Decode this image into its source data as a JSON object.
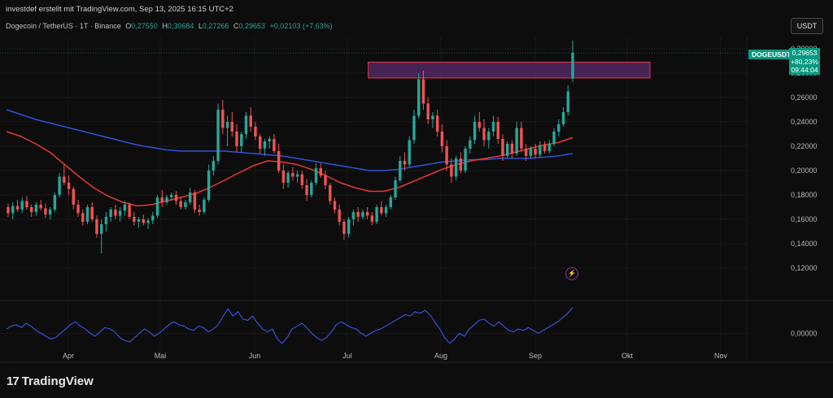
{
  "header": {
    "attribution": "investdef erstellt mit TradingView.com, Sep 13, 2025 16:15 UTC+2",
    "symbol_line": "Dogecoin / TetherUS · 1T · Binance",
    "o_label": "O",
    "o_value": "0,27550",
    "h_label": "H",
    "h_value": "0,30684",
    "l_label": "L",
    "l_value": "0,27266",
    "c_label": "C",
    "c_value": "0,29653",
    "change": "+0,02103 (+7,63%)"
  },
  "currency_button": "USDT",
  "price_tag": {
    "symbol": "DOGEUSDT",
    "price": "0,29653",
    "change_pct": "+80,23%",
    "countdown": "09:44:04"
  },
  "logo": {
    "mark": "17",
    "text": "TradingView"
  },
  "colors": {
    "up": "#26a69a",
    "down": "#ef5350",
    "ma_fast": "#e53935",
    "ma_slow": "#2f52d6",
    "oscillator": "#3d5afe",
    "zone_fill": "#5b2a6e",
    "zone_border": "#e53950",
    "background": "#0d0d0d"
  },
  "chart_data": {
    "type": "candlestick",
    "y_ticks": [
      "0,30000",
      "0,28000",
      "0,26000",
      "0,24000",
      "0,22000",
      "0,20000",
      "0,18000",
      "0,16000",
      "0,14000",
      "0,12000"
    ],
    "ylim": [
      0.11,
      0.31
    ],
    "x_ticks": [
      "Apr",
      "Mai",
      "Jun",
      "Jul",
      "Aug",
      "Sep",
      "Okt",
      "Nov"
    ],
    "candles": [
      [
        0.17,
        0.173,
        0.162,
        0.165
      ],
      [
        0.165,
        0.174,
        0.16,
        0.171
      ],
      [
        0.171,
        0.176,
        0.166,
        0.168
      ],
      [
        0.168,
        0.178,
        0.165,
        0.175
      ],
      [
        0.175,
        0.179,
        0.168,
        0.17
      ],
      [
        0.17,
        0.172,
        0.162,
        0.166
      ],
      [
        0.166,
        0.174,
        0.163,
        0.172
      ],
      [
        0.172,
        0.176,
        0.167,
        0.169
      ],
      [
        0.169,
        0.173,
        0.161,
        0.164
      ],
      [
        0.164,
        0.17,
        0.16,
        0.168
      ],
      [
        0.168,
        0.182,
        0.166,
        0.18
      ],
      [
        0.18,
        0.198,
        0.178,
        0.195
      ],
      [
        0.195,
        0.205,
        0.188,
        0.19
      ],
      [
        0.19,
        0.196,
        0.18,
        0.185
      ],
      [
        0.185,
        0.187,
        0.168,
        0.172
      ],
      [
        0.172,
        0.176,
        0.162,
        0.165
      ],
      [
        0.165,
        0.168,
        0.155,
        0.158
      ],
      [
        0.158,
        0.172,
        0.156,
        0.17
      ],
      [
        0.17,
        0.174,
        0.158,
        0.16
      ],
      [
        0.16,
        0.163,
        0.145,
        0.148
      ],
      [
        0.148,
        0.16,
        0.132,
        0.156
      ],
      [
        0.156,
        0.166,
        0.15,
        0.162
      ],
      [
        0.162,
        0.17,
        0.158,
        0.168
      ],
      [
        0.168,
        0.172,
        0.16,
        0.163
      ],
      [
        0.163,
        0.17,
        0.158,
        0.167
      ],
      [
        0.167,
        0.175,
        0.163,
        0.172
      ],
      [
        0.172,
        0.174,
        0.16,
        0.162
      ],
      [
        0.162,
        0.166,
        0.155,
        0.158
      ],
      [
        0.158,
        0.162,
        0.153,
        0.16
      ],
      [
        0.16,
        0.164,
        0.155,
        0.157
      ],
      [
        0.157,
        0.161,
        0.152,
        0.159
      ],
      [
        0.159,
        0.166,
        0.156,
        0.163
      ],
      [
        0.163,
        0.18,
        0.161,
        0.178
      ],
      [
        0.178,
        0.184,
        0.17,
        0.174
      ],
      [
        0.174,
        0.18,
        0.172,
        0.178
      ],
      [
        0.178,
        0.182,
        0.175,
        0.18
      ],
      [
        0.18,
        0.183,
        0.172,
        0.175
      ],
      [
        0.175,
        0.178,
        0.168,
        0.17
      ],
      [
        0.17,
        0.176,
        0.168,
        0.174
      ],
      [
        0.174,
        0.186,
        0.172,
        0.182
      ],
      [
        0.182,
        0.184,
        0.165,
        0.168
      ],
      [
        0.168,
        0.172,
        0.163,
        0.166
      ],
      [
        0.166,
        0.178,
        0.164,
        0.176
      ],
      [
        0.176,
        0.205,
        0.174,
        0.2
      ],
      [
        0.2,
        0.212,
        0.196,
        0.208
      ],
      [
        0.208,
        0.255,
        0.205,
        0.25
      ],
      [
        0.25,
        0.258,
        0.23,
        0.235
      ],
      [
        0.235,
        0.245,
        0.22,
        0.24
      ],
      [
        0.24,
        0.248,
        0.228,
        0.232
      ],
      [
        0.232,
        0.238,
        0.215,
        0.22
      ],
      [
        0.22,
        0.232,
        0.215,
        0.23
      ],
      [
        0.23,
        0.248,
        0.226,
        0.245
      ],
      [
        0.245,
        0.252,
        0.232,
        0.236
      ],
      [
        0.236,
        0.24,
        0.225,
        0.228
      ],
      [
        0.228,
        0.23,
        0.214,
        0.218
      ],
      [
        0.218,
        0.226,
        0.212,
        0.224
      ],
      [
        0.224,
        0.228,
        0.218,
        0.226
      ],
      [
        0.226,
        0.23,
        0.214,
        0.216
      ],
      [
        0.216,
        0.222,
        0.198,
        0.2
      ],
      [
        0.2,
        0.205,
        0.185,
        0.19
      ],
      [
        0.19,
        0.2,
        0.186,
        0.198
      ],
      [
        0.198,
        0.203,
        0.192,
        0.195
      ],
      [
        0.195,
        0.2,
        0.19,
        0.197
      ],
      [
        0.197,
        0.2,
        0.185,
        0.188
      ],
      [
        0.188,
        0.193,
        0.175,
        0.18
      ],
      [
        0.18,
        0.192,
        0.178,
        0.19
      ],
      [
        0.19,
        0.206,
        0.188,
        0.202
      ],
      [
        0.202,
        0.206,
        0.194,
        0.196
      ],
      [
        0.196,
        0.2,
        0.185,
        0.188
      ],
      [
        0.188,
        0.19,
        0.172,
        0.175
      ],
      [
        0.175,
        0.178,
        0.165,
        0.168
      ],
      [
        0.168,
        0.172,
        0.155,
        0.158
      ],
      [
        0.158,
        0.16,
        0.143,
        0.148
      ],
      [
        0.148,
        0.162,
        0.145,
        0.16
      ],
      [
        0.16,
        0.168,
        0.155,
        0.166
      ],
      [
        0.166,
        0.17,
        0.158,
        0.162
      ],
      [
        0.162,
        0.168,
        0.16,
        0.166
      ],
      [
        0.166,
        0.17,
        0.16,
        0.163
      ],
      [
        0.163,
        0.166,
        0.155,
        0.158
      ],
      [
        0.158,
        0.172,
        0.156,
        0.17
      ],
      [
        0.17,
        0.175,
        0.163,
        0.165
      ],
      [
        0.165,
        0.172,
        0.162,
        0.17
      ],
      [
        0.17,
        0.18,
        0.168,
        0.178
      ],
      [
        0.178,
        0.195,
        0.176,
        0.192
      ],
      [
        0.192,
        0.212,
        0.19,
        0.208
      ],
      [
        0.208,
        0.215,
        0.2,
        0.205
      ],
      [
        0.205,
        0.228,
        0.203,
        0.225
      ],
      [
        0.225,
        0.25,
        0.222,
        0.245
      ],
      [
        0.245,
        0.28,
        0.243,
        0.275
      ],
      [
        0.275,
        0.282,
        0.25,
        0.255
      ],
      [
        0.255,
        0.26,
        0.238,
        0.242
      ],
      [
        0.242,
        0.248,
        0.235,
        0.245
      ],
      [
        0.245,
        0.25,
        0.228,
        0.232
      ],
      [
        0.232,
        0.238,
        0.215,
        0.22
      ],
      [
        0.22,
        0.225,
        0.2,
        0.205
      ],
      [
        0.205,
        0.21,
        0.19,
        0.195
      ],
      [
        0.195,
        0.212,
        0.192,
        0.21
      ],
      [
        0.21,
        0.215,
        0.198,
        0.2
      ],
      [
        0.2,
        0.22,
        0.198,
        0.218
      ],
      [
        0.218,
        0.228,
        0.214,
        0.225
      ],
      [
        0.225,
        0.245,
        0.222,
        0.24
      ],
      [
        0.24,
        0.248,
        0.232,
        0.235
      ],
      [
        0.235,
        0.242,
        0.22,
        0.225
      ],
      [
        0.225,
        0.235,
        0.218,
        0.232
      ],
      [
        0.232,
        0.245,
        0.228,
        0.24
      ],
      [
        0.24,
        0.244,
        0.222,
        0.226
      ],
      [
        0.226,
        0.23,
        0.208,
        0.212
      ],
      [
        0.212,
        0.224,
        0.21,
        0.222
      ],
      [
        0.222,
        0.225,
        0.21,
        0.214
      ],
      [
        0.214,
        0.24,
        0.212,
        0.235
      ],
      [
        0.235,
        0.24,
        0.215,
        0.218
      ],
      [
        0.218,
        0.222,
        0.208,
        0.212
      ],
      [
        0.212,
        0.22,
        0.21,
        0.218
      ],
      [
        0.218,
        0.222,
        0.21,
        0.213
      ],
      [
        0.213,
        0.224,
        0.211,
        0.221
      ],
      [
        0.221,
        0.224,
        0.214,
        0.216
      ],
      [
        0.216,
        0.225,
        0.214,
        0.222
      ],
      [
        0.222,
        0.235,
        0.22,
        0.232
      ],
      [
        0.232,
        0.242,
        0.228,
        0.238
      ],
      [
        0.238,
        0.252,
        0.236,
        0.248
      ],
      [
        0.248,
        0.27,
        0.245,
        0.265
      ],
      [
        0.2755,
        0.30684,
        0.27266,
        0.29653
      ]
    ],
    "moving_average_fast": [
      0.232,
      0.228,
      0.222,
      0.215,
      0.205,
      0.195,
      0.186,
      0.179,
      0.174,
      0.171,
      0.172,
      0.175,
      0.178,
      0.181,
      0.186,
      0.192,
      0.198,
      0.204,
      0.208,
      0.207,
      0.205,
      0.201,
      0.196,
      0.19,
      0.186,
      0.183,
      0.183,
      0.186,
      0.191,
      0.196,
      0.201,
      0.205,
      0.208,
      0.21,
      0.212,
      0.215,
      0.218,
      0.221,
      0.223,
      0.227
    ],
    "moving_average_slow": [
      0.25,
      0.246,
      0.242,
      0.239,
      0.236,
      0.233,
      0.23,
      0.227,
      0.224,
      0.221,
      0.219,
      0.217,
      0.216,
      0.216,
      0.216,
      0.216,
      0.215,
      0.214,
      0.213,
      0.212,
      0.21,
      0.208,
      0.206,
      0.204,
      0.202,
      0.2,
      0.2,
      0.201,
      0.203,
      0.205,
      0.207,
      0.208,
      0.209,
      0.209,
      0.21,
      0.21,
      0.21,
      0.211,
      0.212,
      0.214
    ],
    "resistance_zone": [
      0.276,
      0.289
    ],
    "current_price": 0.29653,
    "oscillator_ticks": [
      "0,00000"
    ],
    "oscillator": [
      0.3,
      0.5,
      0.6,
      0.4,
      0.7,
      0.5,
      0.2,
      0.0,
      -0.2,
      -0.4,
      -0.3,
      0.0,
      0.3,
      0.6,
      0.8,
      0.5,
      0.3,
      0.0,
      -0.2,
      0.1,
      0.4,
      0.3,
      0.1,
      -0.3,
      -0.5,
      -0.6,
      -0.3,
      0.0,
      0.3,
      0.1,
      -0.2,
      0.0,
      0.3,
      0.6,
      0.8,
      0.6,
      0.5,
      0.3,
      0.2,
      0.5,
      0.4,
      0.1,
      0.3,
      0.6,
      1.2,
      1.7,
      1.2,
      1.5,
      1.0,
      0.9,
      1.2,
      0.7,
      0.3,
      0.1,
      0.3,
      -0.4,
      -0.7,
      -0.3,
      0.3,
      0.5,
      0.7,
      0.4,
      0.0,
      -0.3,
      -0.5,
      -0.3,
      0.1,
      0.6,
      0.8,
      0.6,
      0.4,
      0.3,
      0.0,
      -0.2,
      0.0,
      0.2,
      0.3,
      0.5,
      0.7,
      0.9,
      1.1,
      1.3,
      1.2,
      1.5,
      1.4,
      1.6,
      1.3,
      0.8,
      0.3,
      -0.3,
      -0.7,
      -0.4,
      0.0,
      -0.2,
      0.3,
      0.6,
      0.9,
      1.0,
      0.7,
      0.5,
      0.8,
      0.5,
      0.2,
      0.1,
      0.3,
      0.2,
      0.4,
      0.2,
      0.0,
      0.2,
      0.4,
      0.6,
      0.8,
      1.1,
      1.4,
      1.8
    ]
  }
}
